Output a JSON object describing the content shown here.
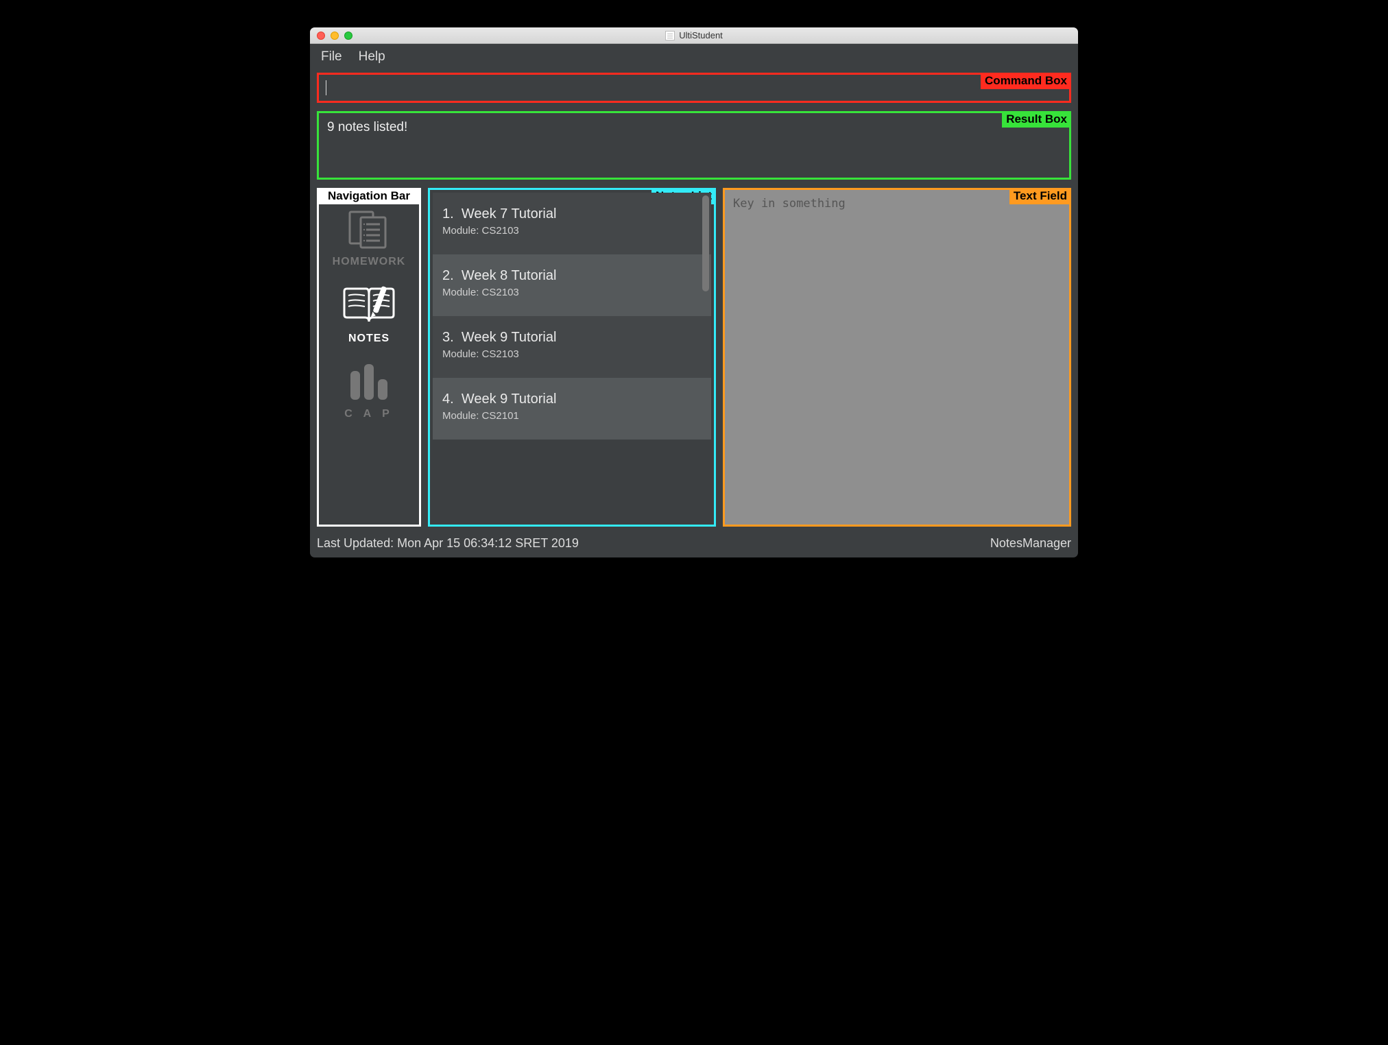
{
  "window": {
    "title": "UltiStudent"
  },
  "menu": {
    "file": "File",
    "help": "Help"
  },
  "annotations": {
    "command": "Command Box",
    "result": "Result Box",
    "nav": "Navigation Bar",
    "notes_list": "Notes List",
    "text_field": "Text Field"
  },
  "result": {
    "message": "9 notes listed!"
  },
  "nav": {
    "items": [
      {
        "label": "HOMEWORK",
        "active": false
      },
      {
        "label": "NOTES",
        "active": true
      },
      {
        "label": "C A P",
        "active": false
      }
    ]
  },
  "notes": [
    {
      "index": "1.",
      "title": "Week 7 Tutorial",
      "module_prefix": "Module: ",
      "module": "CS2103"
    },
    {
      "index": "2.",
      "title": "Week 8 Tutorial",
      "module_prefix": "Module: ",
      "module": "CS2103"
    },
    {
      "index": "3.",
      "title": "Week 9 Tutorial",
      "module_prefix": "Module: ",
      "module": "CS2103"
    },
    {
      "index": "4.",
      "title": "Week 9 Tutorial",
      "module_prefix": "Module: ",
      "module": "CS2101"
    }
  ],
  "text_field": {
    "placeholder": "Key in something"
  },
  "status": {
    "last_updated": "Last Updated: Mon Apr 15 06:34:12 SRET 2019",
    "mode": "NotesManager"
  },
  "command": {
    "value": ""
  }
}
